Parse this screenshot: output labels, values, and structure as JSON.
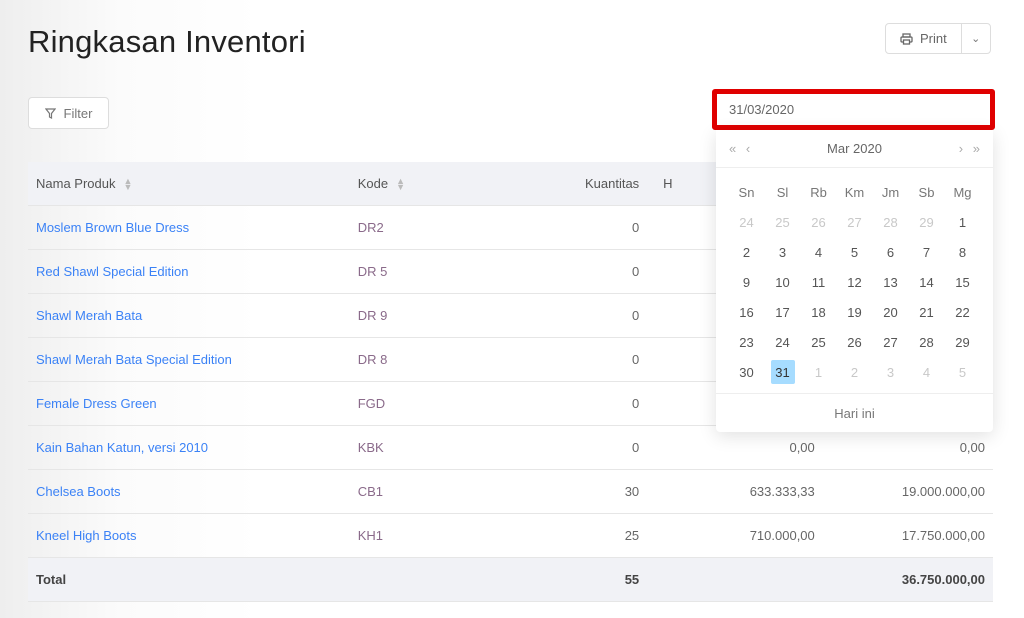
{
  "title": "Ringkasan Inventori",
  "toolbar": {
    "print_label": "Print",
    "filter_label": "Filter"
  },
  "table": {
    "headers": [
      "Nama Produk",
      "Kode",
      "Kuantitas",
      "H",
      ""
    ],
    "rows": [
      [
        "Moslem Brown Blue Dress",
        "DR2",
        "0",
        "",
        ""
      ],
      [
        "Red Shawl Special Edition",
        "DR 5",
        "0",
        "",
        ""
      ],
      [
        "Shawl Merah Bata",
        "DR 9",
        "0",
        "",
        ""
      ],
      [
        "Shawl Merah Bata Special Edition",
        "DR 8",
        "0",
        "",
        ""
      ],
      [
        "Female Dress Green",
        "FGD",
        "0",
        "",
        ""
      ],
      [
        "Kain Bahan Katun, versi 2010",
        "KBK",
        "0",
        "0,00",
        "0,00"
      ],
      [
        "Chelsea Boots",
        "CB1",
        "30",
        "633.333,33",
        "19.000.000,00"
      ],
      [
        "Kneel High Boots",
        "KH1",
        "25",
        "710.000,00",
        "17.750.000,00"
      ]
    ],
    "total": {
      "label": "Total",
      "quantity": "55",
      "value": "36.750.000,00"
    }
  },
  "datepicker": {
    "value": "31/03/2020",
    "month_label": "Mar 2020",
    "nav": {
      "prev_year": "«",
      "prev_month": "‹",
      "next_month": "›",
      "next_year": "»"
    },
    "day_names": [
      "Sn",
      "Sl",
      "Rb",
      "Km",
      "Jm",
      "Sb",
      "Mg"
    ],
    "weeks": [
      [
        "24",
        "25",
        "26",
        "27",
        "28",
        "29",
        "1"
      ],
      [
        "2",
        "3",
        "4",
        "5",
        "6",
        "7",
        "8"
      ],
      [
        "9",
        "10",
        "11",
        "12",
        "13",
        "14",
        "15"
      ],
      [
        "16",
        "17",
        "18",
        "19",
        "20",
        "21",
        "22"
      ],
      [
        "23",
        "24",
        "25",
        "26",
        "27",
        "28",
        "29"
      ],
      [
        "30",
        "31",
        "1",
        "2",
        "3",
        "4",
        "5"
      ]
    ],
    "selected": "31",
    "today_label": "Hari ini",
    "highlight_color": "#e00000",
    "selected_color": "#a6dcff"
  }
}
